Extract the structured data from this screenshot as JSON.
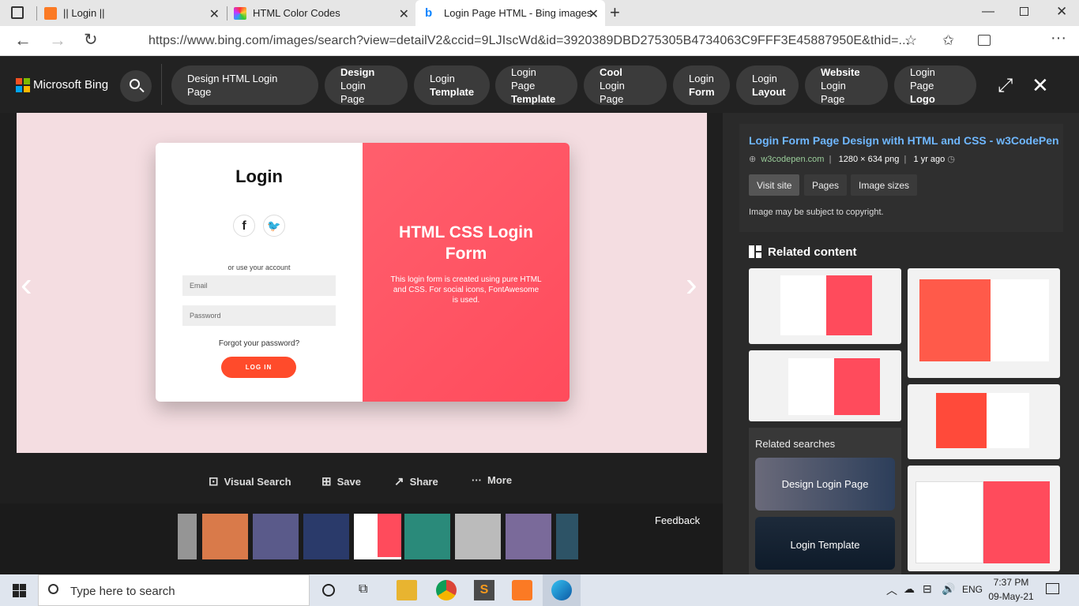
{
  "tabs": [
    {
      "label": "|| Login ||"
    },
    {
      "label": "HTML Color Codes"
    },
    {
      "label": "Login Page HTML - Bing images"
    }
  ],
  "address": {
    "url": "https://www.bing.com/images/search?view=detailV2&ccid=9LJIscWd&id=3920389DBD275305B4734063C9FFF3E45887950E&thid=..."
  },
  "bing": {
    "brand": "Microsoft Bing"
  },
  "chips": [
    {
      "l1": "Design HTML Login Page",
      "l2": ""
    },
    {
      "l1": "Design",
      "l2": "Login Page"
    },
    {
      "l1": "Login",
      "l2": "Template"
    },
    {
      "l1": "Login Page",
      "l2": "Template"
    },
    {
      "l1": "Cool",
      "l2": "Login Page"
    },
    {
      "l1": "Login",
      "l2": "Form"
    },
    {
      "l1": "Login",
      "l2": "Layout"
    },
    {
      "l1": "Website",
      "l2": "Login Page"
    },
    {
      "l1": "Login Page",
      "l2": "Logo"
    }
  ],
  "preview": {
    "title": "Login",
    "or_text": "or use your account",
    "email_placeholder": "Email",
    "password_placeholder": "Password",
    "forgot": "Forgot your password?",
    "login_btn": "LOG IN",
    "right_title": "HTML CSS Login Form",
    "right_desc": "This login form is created using pure HTML and CSS. For social icons, FontAwesome is used."
  },
  "actions": {
    "visual_search": "Visual Search",
    "save": "Save",
    "share": "Share",
    "more": "More"
  },
  "feedback": "Feedback",
  "detail": {
    "title": "Login Form Page Design with HTML and CSS - w3CodePen",
    "site": "w3codepen.com",
    "size": "1280 × 634 png",
    "age": "1 yr ago",
    "visit": "Visit site",
    "pages": "Pages",
    "image_sizes": "Image sizes",
    "copyright": "Image may be subject to copyright."
  },
  "related": {
    "heading": "Related content",
    "searches_heading": "Related searches",
    "searches": [
      "Design Login Page",
      "Login Template"
    ]
  },
  "taskbar": {
    "search_placeholder": "Type here to search",
    "lang": "ENG",
    "time": "7:37 PM",
    "date": "09-May-21"
  },
  "colors": {
    "accent": "#ff4b5c",
    "button": "#ff4b2b",
    "link": "#6fb7ff"
  }
}
